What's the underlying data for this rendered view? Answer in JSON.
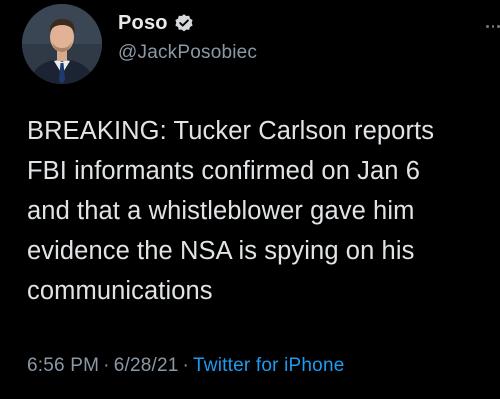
{
  "author": {
    "display_name": "Poso",
    "handle": "@JackPosobiec",
    "verified": true,
    "avatar_icon": "profile-photo"
  },
  "tweet": {
    "lines": [
      "BREAKING: Tucker Carlson reports",
      "FBI informants confirmed on Jan 6",
      "and that a whistleblower gave him",
      "evidence the NSA is spying on his",
      "communications"
    ]
  },
  "meta": {
    "time": "6:56 PM",
    "date": "6/28/21",
    "separator": "·",
    "source": "Twitter for iPhone"
  },
  "colors": {
    "background": "#000000",
    "link": "#1d9bf0",
    "muted": "#8b98a5",
    "text": "#e1e4e6"
  }
}
